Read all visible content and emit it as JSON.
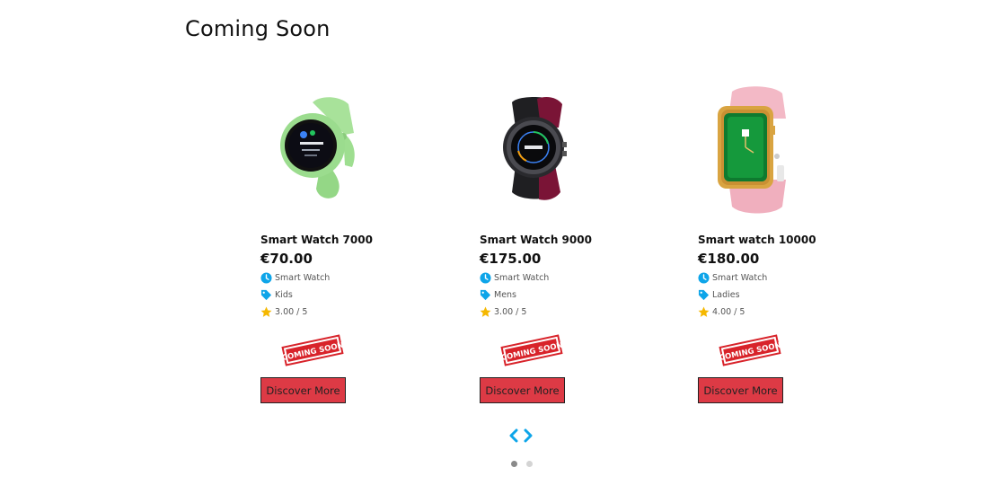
{
  "section": {
    "title": "Coming Soon"
  },
  "colors": {
    "accent": "#0ea5e9",
    "button": "#dd3a45",
    "star": "#f5b800",
    "stamp": "#d8232a"
  },
  "products": [
    {
      "name": "Smart Watch 7000",
      "price": "€70.00",
      "category": "Smart Watch",
      "tag": "Kids",
      "rating": "3.00 / 5",
      "stamp_text": "COMING SOON",
      "button_label": "Discover More",
      "strap_color": "#9bdc8e"
    },
    {
      "name": "Smart Watch 9000",
      "price": "€175.00",
      "category": "Smart Watch",
      "tag": "Mens",
      "rating": "3.00 / 5",
      "stamp_text": "COMING SOON",
      "button_label": "Discover More",
      "strap_color": "#7a1436"
    },
    {
      "name": "Smart watch 10000",
      "price": "€180.00",
      "category": "Smart Watch",
      "tag": "Ladies",
      "rating": "4.00 / 5",
      "stamp_text": "COMING SOON",
      "button_label": "Discover More",
      "strap_color": "#f3b9c6"
    }
  ],
  "carousel": {
    "prev_icon": "chevron-left-icon",
    "next_icon": "chevron-right-icon",
    "pages": 2,
    "active_page": 1
  }
}
